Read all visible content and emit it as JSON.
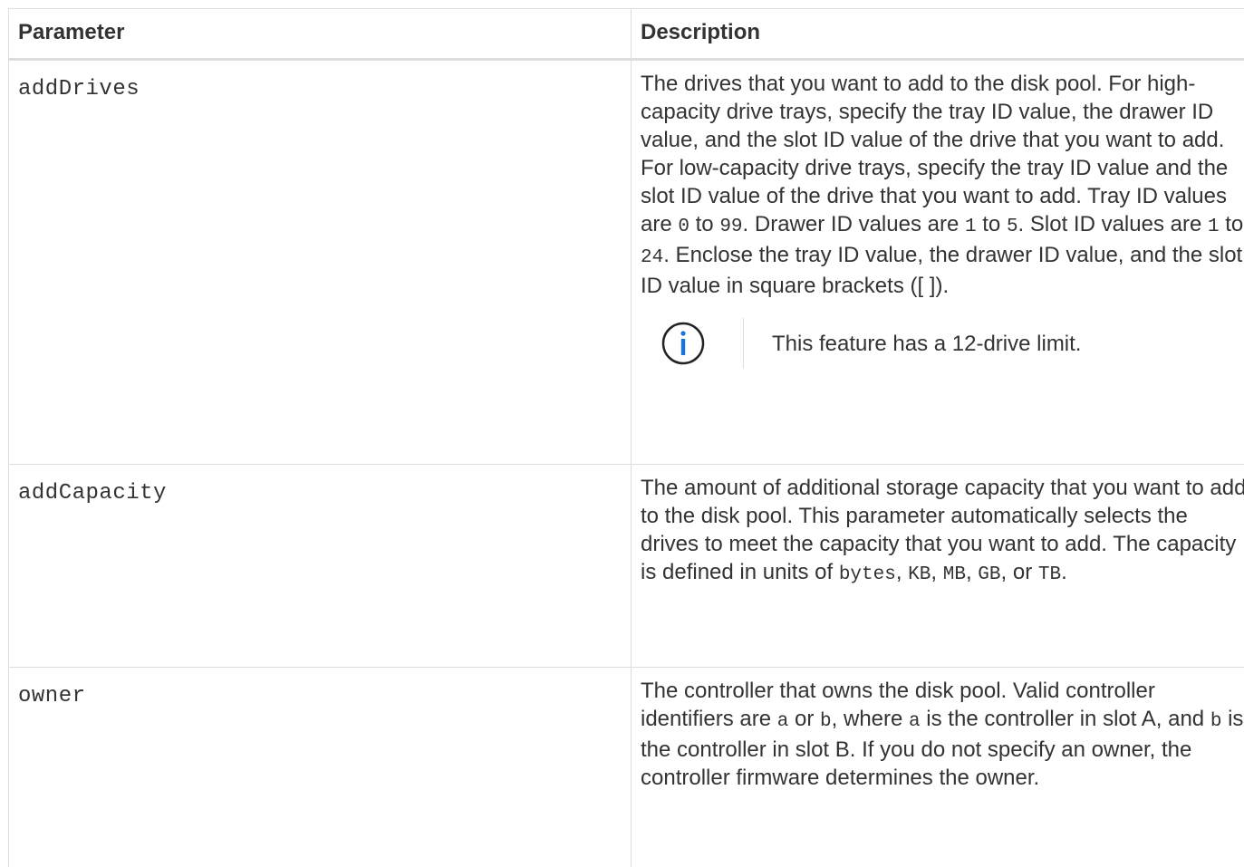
{
  "table": {
    "headers": {
      "parameter": "Parameter",
      "description": "Description"
    },
    "rows": [
      {
        "parameter": "addDrives",
        "desc": {
          "t1": "The drives that you want to add to the disk pool. For high-capacity drive trays, specify the tray ID value, the drawer ID value, and the slot ID value of the drive that you want to add. For low-capacity drive trays, specify the tray ID value and the slot ID value of the drive that you want to add. Tray ID values are ",
          "c1": "0",
          "t2": " to ",
          "c2": "99",
          "t3": ". Drawer ID values are ",
          "c3": "1",
          "t4": " to ",
          "c4": "5",
          "t5": ". Slot ID values are ",
          "c5": "1",
          "t6": " to ",
          "c6": "24",
          "t7": ". Enclose the tray ID value, the drawer ID value, and the slot ID value in square brackets ([ ])."
        },
        "note": {
          "icon": "info-circle-icon",
          "text": "This feature has a 12-drive limit."
        }
      },
      {
        "parameter": "addCapacity",
        "desc": {
          "t1": "The amount of additional storage capacity that you want to add to the disk pool. This parameter automatically selects the drives to meet the capacity that you want to add. The capacity is defined in units of ",
          "c1": "bytes",
          "t2": ", ",
          "c2": "KB",
          "t3": ", ",
          "c3": "MB",
          "t4": ", ",
          "c4": "GB",
          "t5": ", or ",
          "c5": "TB",
          "t6": "."
        }
      },
      {
        "parameter": "owner",
        "desc": {
          "t1": "The controller that owns the disk pool. Valid controller identifiers are ",
          "c1": "a",
          "t2": " or ",
          "c2": "b",
          "t3": ", where ",
          "c3": "a",
          "t4": " is the controller in slot A, and ",
          "c4": "b",
          "t5": " is the controller in slot B. If you do not specify an owner, the controller firmware determines the owner."
        }
      }
    ]
  },
  "colors": {
    "text": "#333333",
    "border": "#dddddd",
    "info_icon": "#1a73d9"
  }
}
